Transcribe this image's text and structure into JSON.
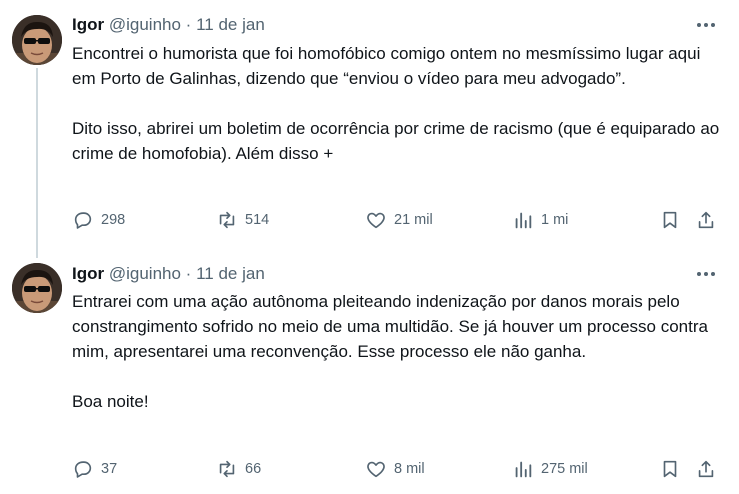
{
  "tweets": [
    {
      "name": "Igor",
      "handle": "@iguinho",
      "separator": "·",
      "date": "11 de jan",
      "paragraphs": [
        "Encontrei o humorista que foi homofóbico comigo ontem no mesmíssimo lugar aqui em Porto de Galinhas, dizendo que “enviou o vídeo para meu advogado”.",
        "Dito isso, abrirei um boletim de ocorrência por crime de racismo (que é equiparado ao crime de homofobia). Além disso +"
      ],
      "stats": {
        "replies": "298",
        "reposts": "514",
        "likes": "21 mil",
        "views": "1 mi"
      }
    },
    {
      "name": "Igor",
      "handle": "@iguinho",
      "separator": "·",
      "date": "11 de jan",
      "paragraphs": [
        "Entrarei com uma ação autônoma pleiteando indenização por danos morais pelo constrangimento sofrido no meio de uma multidão. Se já houver um processo contra mim, apresentarei uma reconvenção. Esse processo ele não ganha.",
        "Boa noite!"
      ],
      "stats": {
        "replies": "37",
        "reposts": "66",
        "likes": "8 mil",
        "views": "275 mil"
      }
    }
  ],
  "icons": {
    "reply": "reply-icon",
    "repost": "repost-icon",
    "like": "like-icon",
    "views": "views-icon",
    "bookmark": "bookmark-icon",
    "share": "share-icon",
    "more": "more-icon"
  },
  "colors": {
    "text": "#0f1419",
    "secondary": "#536471",
    "thread_line": "#cfd9de"
  }
}
